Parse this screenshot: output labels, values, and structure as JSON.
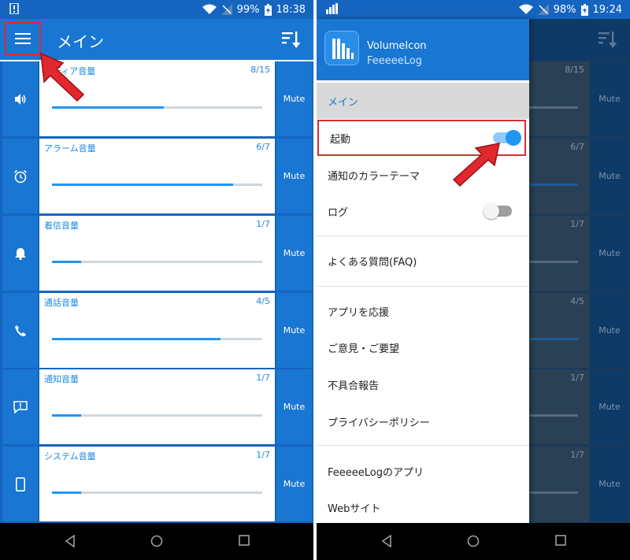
{
  "left": {
    "status": {
      "battery": "99%",
      "time": "18:38"
    },
    "title": "メイン",
    "rows": [
      {
        "label": "メディア音量",
        "count": "8/15",
        "level": 0.53,
        "icon": "speaker-icon",
        "mute": "Mute"
      },
      {
        "label": "アラーム音量",
        "count": "6/7",
        "level": 0.86,
        "icon": "alarm-icon",
        "mute": "Mute"
      },
      {
        "label": "着信音量",
        "count": "1/7",
        "level": 0.14,
        "icon": "bell-icon",
        "mute": "Mute"
      },
      {
        "label": "通話音量",
        "count": "4/5",
        "level": 0.8,
        "icon": "phone-icon",
        "mute": "Mute"
      },
      {
        "label": "通知音量",
        "count": "1/7",
        "level": 0.14,
        "icon": "message-icon",
        "mute": "Mute"
      },
      {
        "label": "システム音量",
        "count": "1/7",
        "level": 0.14,
        "icon": "smartphone-icon",
        "mute": "Mute"
      }
    ]
  },
  "right": {
    "status": {
      "battery": "98%",
      "time": "19:24"
    },
    "app_name": "VolumeIcon",
    "developer": "FeeeeeLog",
    "menu": {
      "main": "メイン",
      "launch": "起動",
      "launch_on": true,
      "theme": "通知のカラーテーマ",
      "log": "ログ",
      "log_on": false,
      "faq": "よくある質問(FAQ)",
      "support": "アプリを応援",
      "feedback": "ご意見・ご要望",
      "bug": "不具合報告",
      "privacy": "プライバシーポリシー",
      "apps": "FeeeeeLogのアプリ",
      "web": "Webサイト"
    },
    "bg_counts": [
      "8/15",
      "6/7",
      "1/7",
      "4/5",
      "1/7",
      "1/7"
    ],
    "bg_levels": [
      0.53,
      0.86,
      0.14,
      0.8,
      0.14,
      0.14
    ],
    "bg_mute": "Mute"
  },
  "colors": {
    "primary": "#1976d2",
    "accent": "#2196f3",
    "highlight": "#e0282e"
  }
}
